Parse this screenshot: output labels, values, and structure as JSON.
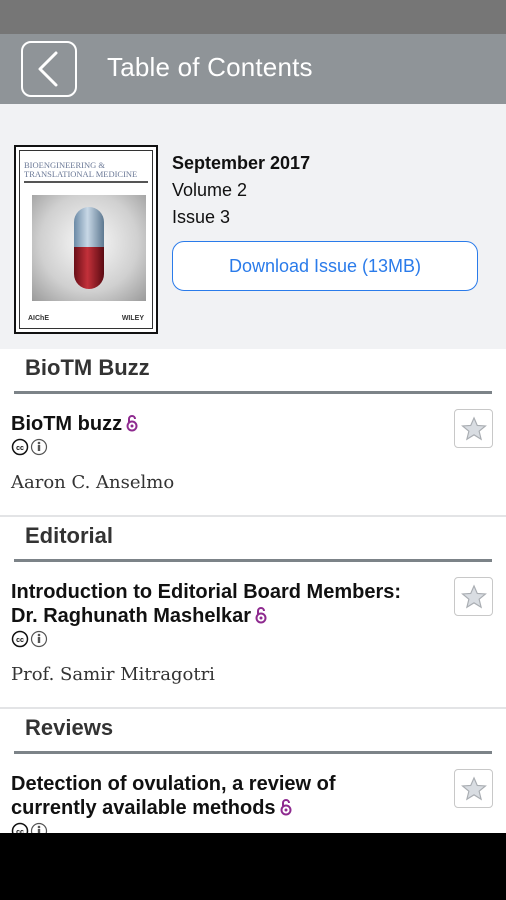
{
  "app_bar": {
    "title": "Table of Contents",
    "back_icon": "chevron-left-icon"
  },
  "issue": {
    "cover": {
      "journal_title_line1": "BIOENGINEERING &",
      "journal_title_line2": "TRANSLATIONAL MEDICINE",
      "logos": [
        "AIChE",
        "WILEY"
      ]
    },
    "date": "September 2017",
    "volume": "Volume 2",
    "issue": "Issue 3",
    "download_label": "Download Issue (13MB)"
  },
  "sections": [
    {
      "title": "BioTM Buzz",
      "articles": [
        {
          "title": "BioTM buzz",
          "open_access": true,
          "license_icons": [
            "cc-icon",
            "attribution-icon"
          ],
          "authors": "Aaron C. Anselmo",
          "favorite_icon": "star-icon"
        }
      ]
    },
    {
      "title": "Editorial",
      "articles": [
        {
          "title": "Introduction to Editorial Board Members: Dr. Raghunath Mashelkar",
          "open_access": true,
          "license_icons": [
            "cc-icon",
            "attribution-icon"
          ],
          "authors": "Prof. Samir Mitragotri",
          "favorite_icon": "star-icon"
        }
      ]
    },
    {
      "title": "Reviews",
      "articles": [
        {
          "title": "Detection of ovulation, a review of currently available methods",
          "open_access": true,
          "license_icons": [
            "cc-icon",
            "attribution-icon"
          ],
          "authors": "",
          "favorite_icon": "star-icon"
        }
      ]
    }
  ],
  "colors": {
    "app_bar": "#8f9498",
    "status_bar": "#767676",
    "accent_blue": "#2a7bea",
    "open_access_purple": "#8e2a8f",
    "section_rule": "#7c8388"
  }
}
